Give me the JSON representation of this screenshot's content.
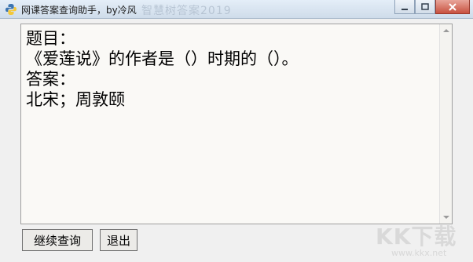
{
  "window": {
    "title": "网课答案查询助手，by冷风",
    "background_text": "智慧树答案2019"
  },
  "content": {
    "question_label": "题目：",
    "question_text": "《爱莲说》的作者是（）时期的（）。",
    "answer_label": "答案：",
    "answer_text": "北宋；周敦颐"
  },
  "buttons": {
    "query": "继续查询",
    "exit": "退出"
  },
  "watermark": {
    "logo": "KK下载",
    "url": "www.kkx.net"
  },
  "icons": {
    "app": "python-icon",
    "minimize": "minimize-icon",
    "maximize": "maximize-icon",
    "close": "close-icon"
  },
  "colors": {
    "titlebar": "#d6e2ef",
    "textarea_bg": "#faf9f6",
    "close_button": "#c8513f"
  }
}
